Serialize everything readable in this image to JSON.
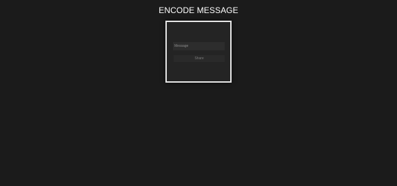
{
  "page": {
    "title": "ENCODE MESSAGE"
  },
  "form": {
    "message_placeholder": "Message",
    "message_value": "",
    "share_label": "Share"
  }
}
